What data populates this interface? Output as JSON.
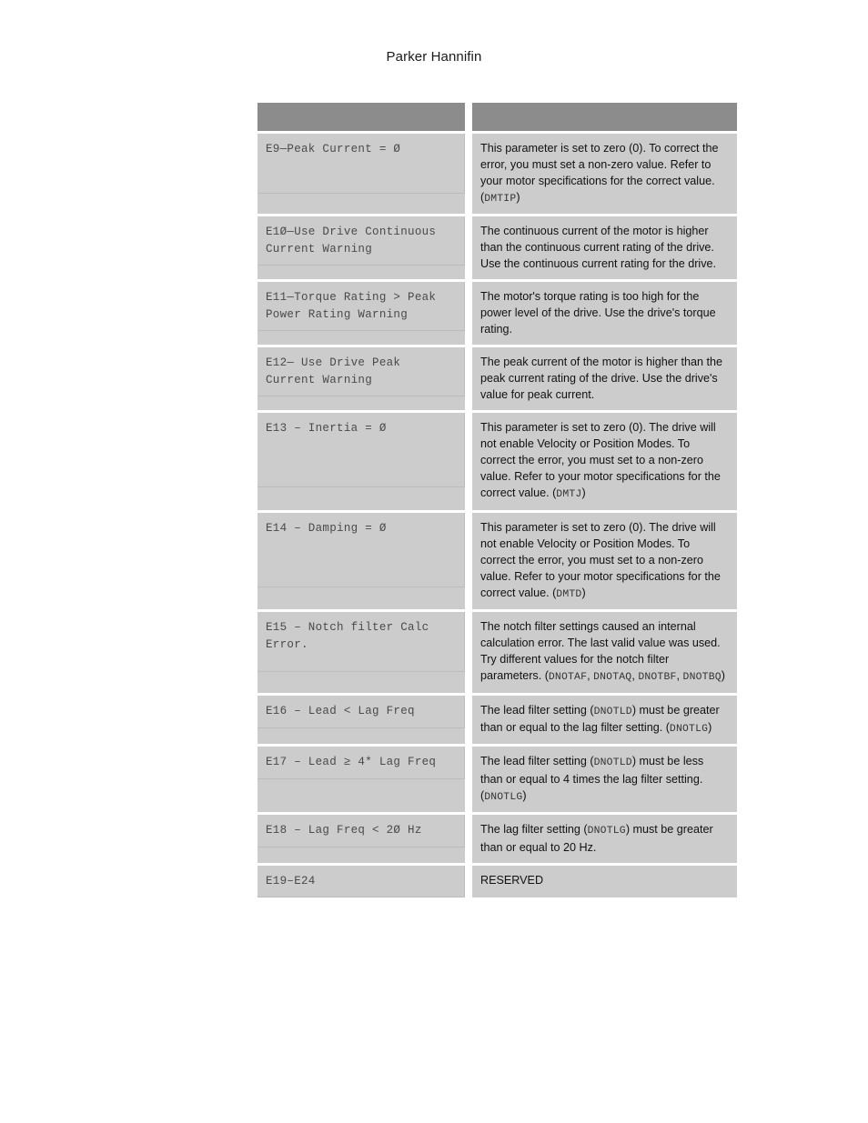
{
  "header": {
    "title": "Parker Hannifin"
  },
  "table": {
    "columns": [
      {
        "label": ""
      },
      {
        "label": ""
      }
    ],
    "rows": [
      {
        "code": "E9—Peak Current = Ø",
        "height_class": "r-h66",
        "desc_parts": [
          {
            "t": "This parameter is set to zero (0). To correct the error, you must set a non-zero value. Refer to your motor specifications for the correct value. (",
            "mono": false
          },
          {
            "t": "DMTIP",
            "mono": true
          },
          {
            "t": ")",
            "mono": false
          }
        ]
      },
      {
        "code": "E1Ø—Use Drive Continuous Current Warning",
        "height_class": "r-h44",
        "desc_parts": [
          {
            "t": "The continuous current of the motor is higher than the continuous current rating of the drive. Use the continuous current rating for the drive.",
            "mono": false
          }
        ]
      },
      {
        "code": "E11—Torque Rating > Peak Power Rating Warning",
        "height_class": "r-h36",
        "desc_parts": [
          {
            "t": "The motor's torque rating is too high for the power level of the drive. Use the drive's torque rating.",
            "mono": false
          }
        ]
      },
      {
        "code": "E12— Use Drive Peak Current Warning",
        "height_class": "r-h44",
        "desc_parts": [
          {
            "t": "The peak current of the motor is higher than the peak current rating of the drive. Use the drive's value for peak current.",
            "mono": false
          }
        ]
      },
      {
        "code": "E13 – Inertia = Ø",
        "height_class": "r-h82",
        "desc_parts": [
          {
            "t": "This parameter is set to zero (0). The drive will not enable Velocity or Position Modes. To correct the error, you must set to a non-zero value. Refer to your motor specifications for the correct value. (",
            "mono": false
          },
          {
            "t": "DMTJ",
            "mono": true
          },
          {
            "t": ")",
            "mono": false
          }
        ]
      },
      {
        "code": "E14 – Damping = Ø",
        "height_class": "r-h82",
        "desc_parts": [
          {
            "t": "This parameter is set to zero (0). The drive will not enable Velocity or Position Modes. To correct the error, you must set to a non-zero value. Refer to your motor specifications for the correct value. (",
            "mono": false
          },
          {
            "t": "DMTD",
            "mono": true
          },
          {
            "t": ")",
            "mono": false
          }
        ]
      },
      {
        "code": "E15 – Notch filter Calc Error.",
        "height_class": "r-h66",
        "desc_parts": [
          {
            "t": "The notch filter settings caused an internal calculation error. The last valid value was used. Try different values for the notch filter parameters. (",
            "mono": false
          },
          {
            "t": "DNOTAF",
            "mono": true
          },
          {
            "t": ", ",
            "mono": false
          },
          {
            "t": "DNOTAQ",
            "mono": true
          },
          {
            "t": ", ",
            "mono": false
          },
          {
            "t": "DNOTBF",
            "mono": true
          },
          {
            "t": ", ",
            "mono": false
          },
          {
            "t": "DNOTBQ",
            "mono": true
          },
          {
            "t": ")",
            "mono": false
          }
        ]
      },
      {
        "code": "E16 – Lead < Lag Freq",
        "height_class": "r-h36",
        "desc_parts": [
          {
            "t": "The lead filter setting (",
            "mono": false
          },
          {
            "t": "DNOTLD",
            "mono": true
          },
          {
            "t": ") must be greater than or equal to the lag filter setting. (",
            "mono": false
          },
          {
            "t": "DNOTLG",
            "mono": true
          },
          {
            "t": ")",
            "mono": false
          }
        ]
      },
      {
        "code": "E17 – Lead ≥ 4* Lag Freq",
        "height_class": "r-h36",
        "desc_parts": [
          {
            "t": "The lead filter setting (",
            "mono": false
          },
          {
            "t": "DNOTLD",
            "mono": true
          },
          {
            "t": ") must be less than or equal to  4 times the lag filter setting. (",
            "mono": false
          },
          {
            "t": "DNOTLG",
            "mono": true
          },
          {
            "t": ")",
            "mono": false
          }
        ]
      },
      {
        "code": "E18 – Lag Freq < 2Ø Hz",
        "height_class": "r-h36",
        "desc_parts": [
          {
            "t": "The lag filter setting (",
            "mono": false
          },
          {
            "t": "DNOTLG",
            "mono": true
          },
          {
            "t": ") must be greater than or equal to 20 Hz.",
            "mono": false
          }
        ]
      },
      {
        "code": "E19–E24",
        "height_class": "r-h20",
        "desc_parts": [
          {
            "t": "RESERVED",
            "mono": false
          }
        ]
      }
    ]
  },
  "colors": {
    "header_band": "#8c8c8c",
    "cell_background": "#cccccc",
    "page_background": "#ffffff",
    "code_text": "#4a4a4a",
    "desc_text": "#111111"
  }
}
